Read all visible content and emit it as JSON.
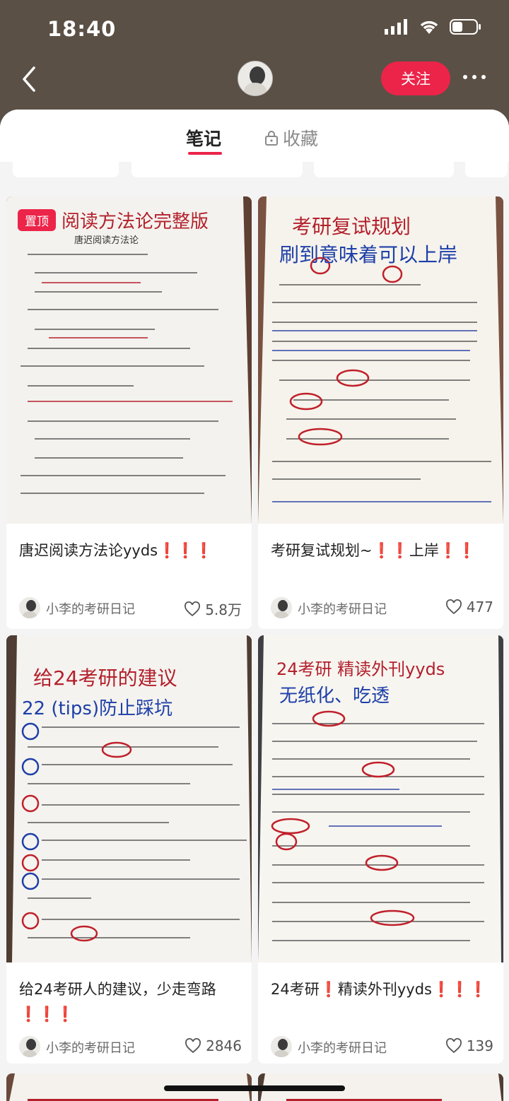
{
  "status_bar": {
    "time": "18:40"
  },
  "header": {
    "follow_label": "关注"
  },
  "tabs": {
    "notes": "笔记",
    "favorites": "收藏"
  },
  "colors": {
    "accent": "#ec2449",
    "header_bg": "#5b5045"
  },
  "cards": [
    {
      "badge": "置顶",
      "image_text": [
        "阅读方法论完整版",
        "唐迟阅读方法论"
      ],
      "title": "唐迟阅读方法论yyds❗❗❗",
      "author": "小李的考研日记",
      "likes": "5.8万"
    },
    {
      "image_text": [
        "考研复试规划",
        "刷到意味着可以上岸"
      ],
      "title": "考研复试规划~❗❗上岸❗❗",
      "author": "小李的考研日记",
      "likes": "477"
    },
    {
      "image_text": [
        "给24考研的建议",
        "22 (tips)防止踩坑"
      ],
      "title": "给24考研人的建议，少走弯路❗❗❗",
      "author": "小李的考研日记",
      "likes": "2846"
    },
    {
      "image_text": [
        "24考研 精读外刊yyds",
        "无纸化、吃透"
      ],
      "title": "24考研❗精读外刊yyds❗❗❗",
      "author": "小李的考研日记",
      "likes": "139"
    }
  ]
}
